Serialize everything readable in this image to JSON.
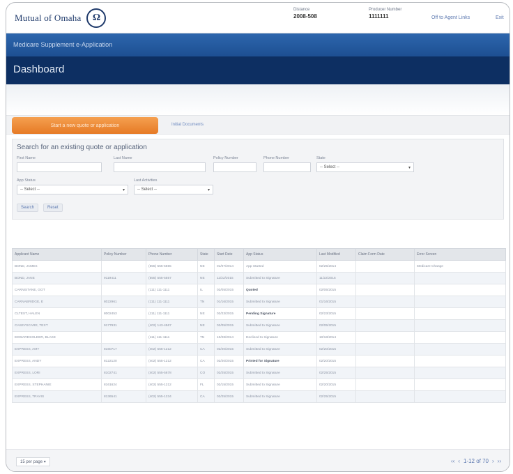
{
  "header": {
    "brand": "Mutual of Omaha",
    "distance_label": "Distance",
    "distance_value": "2008-508",
    "producer_label": "Producer Number",
    "producer_value": "1111111",
    "link_agency": "Off to Agent Links",
    "link_exit": "Exit"
  },
  "product_bar": {
    "title": "Medicare Supplement e-Application"
  },
  "page": {
    "title": "Dashboard"
  },
  "actions": {
    "start_button": "Start a new quote or application",
    "initial_documents": "Initial Documents"
  },
  "search": {
    "title": "Search for an existing quote or application",
    "first_name_label": "First Name",
    "last_name_label": "Last Name",
    "policy_number_label": "Policy Number",
    "phone_number_label": "Phone Number",
    "state_label": "State",
    "state_value": "-- Select --",
    "app_status_label": "App Status",
    "app_status_value": "-- Select --",
    "last_activities_label": "Last Activities",
    "last_activities_value": "-- Select --",
    "search_button": "Search",
    "reset_button": "Reset"
  },
  "table": {
    "columns": [
      "Applicant Name",
      "Policy Number",
      "Phone Number",
      "State",
      "Start Date",
      "App Status",
      "Last Modified",
      "Claim Form Date",
      "Error Screen"
    ],
    "rows": [
      [
        "BOND, JAMES",
        "",
        "(555) 555-5555",
        "NE",
        "01/07/2014",
        "App Started",
        "02/25/2014",
        "",
        "Medicare Change"
      ],
      [
        "BOND, JANE",
        "9119411",
        "(555) 555-5557",
        "NE",
        "11/22/2015",
        "Submitted to Signature",
        "11/22/2015",
        "",
        ""
      ],
      [
        "CARNISTANE, GOT",
        "",
        "(111) 111-1111",
        "IL",
        "02/05/2015",
        "Quoted",
        "02/05/2015",
        "",
        ""
      ],
      [
        "CARNABRIDGE, E",
        "8022961",
        "(111) 111-1111",
        "TN",
        "01/16/2015",
        "Submitted to Signature",
        "01/16/2015",
        "",
        ""
      ],
      [
        "CLTEST, HALEN",
        "8002453",
        "(111) 111-1111",
        "NE",
        "02/23/2015",
        "Pending Signature",
        "02/23/2015",
        "",
        ""
      ],
      [
        "CASEYSCARE, TEXT",
        "9177931",
        "(402) 143-4567",
        "NE",
        "02/05/2015",
        "Submitted to Signature",
        "02/05/2015",
        "",
        ""
      ],
      [
        "EDWARDSOLDER, BLAKE",
        "",
        "(111) 111-1111",
        "TN",
        "10/28/2014",
        "Declined to Signature",
        "10/18/2014",
        "",
        ""
      ],
      [
        "EXPRESS, AMY",
        "8160717",
        "(402) 555-1212",
        "CA",
        "02/20/2015",
        "Submitted to Signature",
        "02/20/2015",
        "",
        ""
      ],
      [
        "EXPRESS, ANDY",
        "8122120",
        "(402) 555-1212",
        "CA",
        "02/20/2015",
        "Printed for Signature",
        "02/20/2015",
        "",
        ""
      ],
      [
        "EXPRESS, LORI",
        "8102741",
        "(402) 555-5678",
        "CO",
        "02/25/2015",
        "Submitted to Signature",
        "02/25/2015",
        "",
        ""
      ],
      [
        "EXPRESS, STEPHANIE",
        "8161624",
        "(402) 555-1212",
        "FL",
        "02/15/2015",
        "Submitted to Signature",
        "02/20/2015",
        "",
        ""
      ],
      [
        "EXPRESS, TRAVIS",
        "8136541",
        "(402) 555-1234",
        "CA",
        "02/25/2015",
        "Submitted to Signature",
        "02/25/2015",
        "",
        ""
      ]
    ],
    "bold_status": [
      "Quoted",
      "Pending Signature",
      "Printed for Signature"
    ]
  },
  "footer": {
    "per_page": "15 per page",
    "range": "1-12 of 70",
    "first": "‹‹",
    "prev": "‹",
    "next": "›",
    "last": "››"
  }
}
